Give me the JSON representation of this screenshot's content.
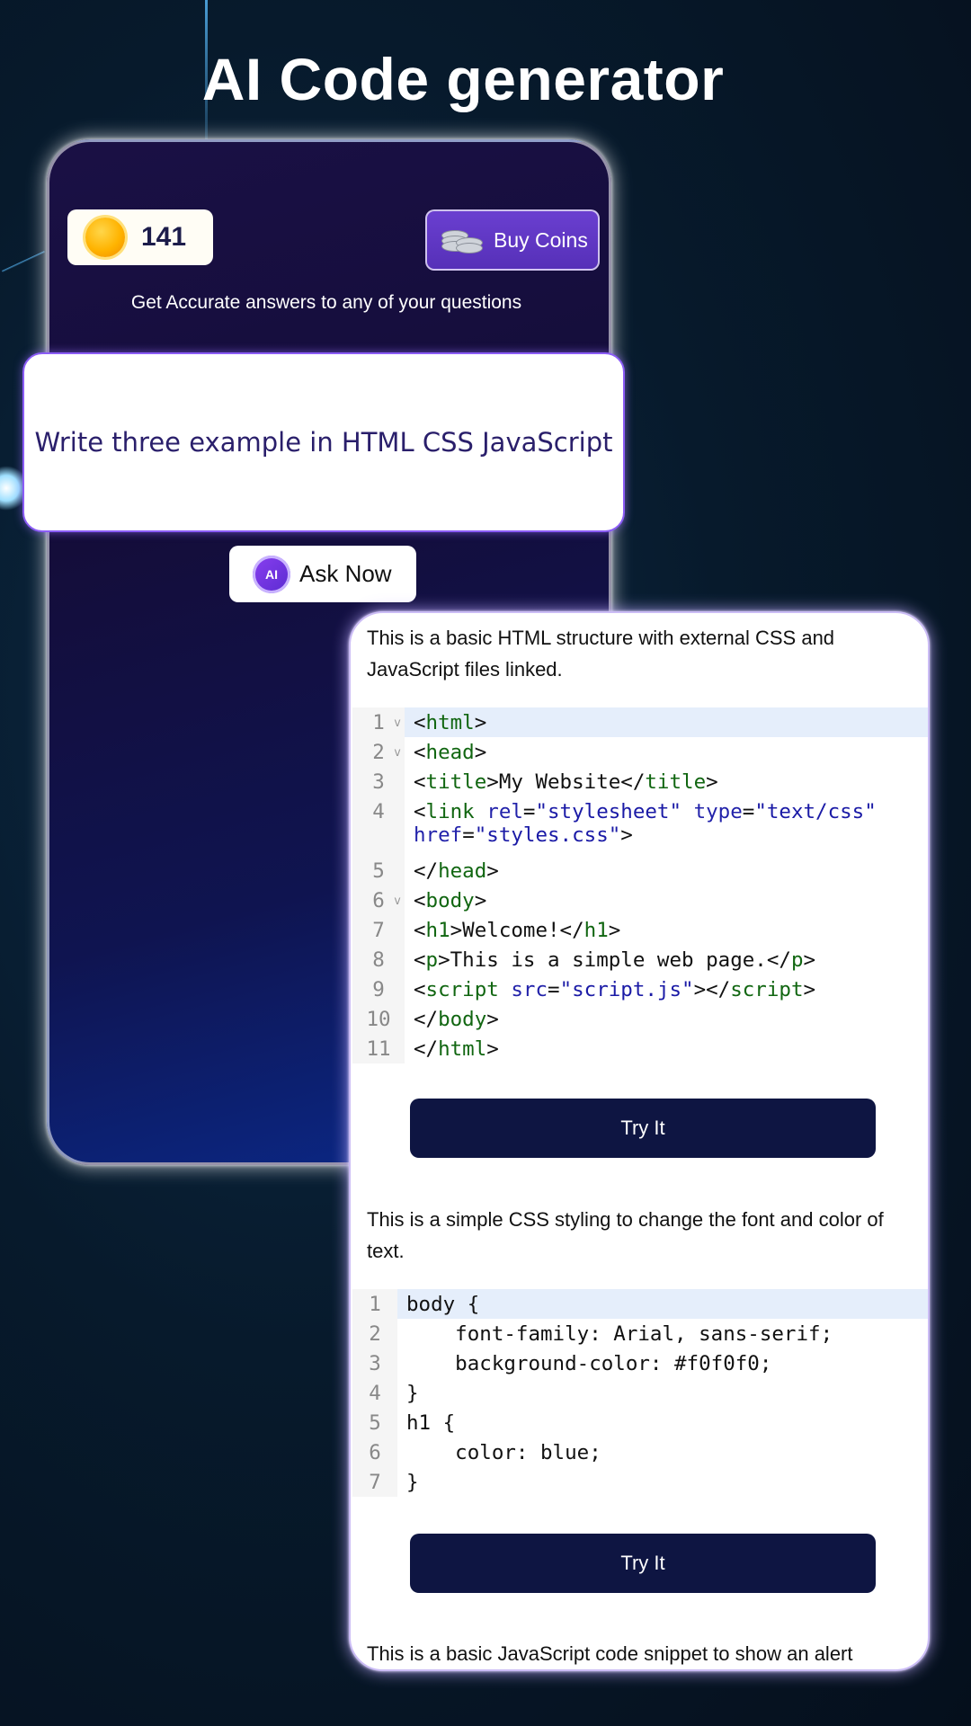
{
  "headline": "AI Code generator",
  "coins": {
    "count": "141",
    "icon": "coin-icon"
  },
  "buy": {
    "label": "Buy Coins",
    "icon": "coin-stack-icon"
  },
  "subtitle": "Get Accurate answers to any of your questions",
  "prompt": "Write three example in HTML CSS JavaScript",
  "ask": {
    "label": "Ask Now",
    "icon_text": "AI"
  },
  "answers": [
    {
      "description": "This is a basic HTML structure with external CSS and JavaScript files linked.",
      "try_label": "Try It"
    },
    {
      "description": "This is a simple CSS styling to change the font and color of text.",
      "try_label": "Try It"
    },
    {
      "description": "This is a basic JavaScript code snippet to show an alert"
    }
  ],
  "css_code": [
    "body {",
    "    font-family: Arial, sans-serif;",
    "    background-color: #f0f0f0;",
    "}",
    "h1 {",
    "    color: blue;",
    "}"
  ],
  "colors": {
    "accent": "#6a3fd0",
    "button_dark": "#0e1542",
    "code_tag": "#116611",
    "code_string": "#1a1aa6"
  }
}
